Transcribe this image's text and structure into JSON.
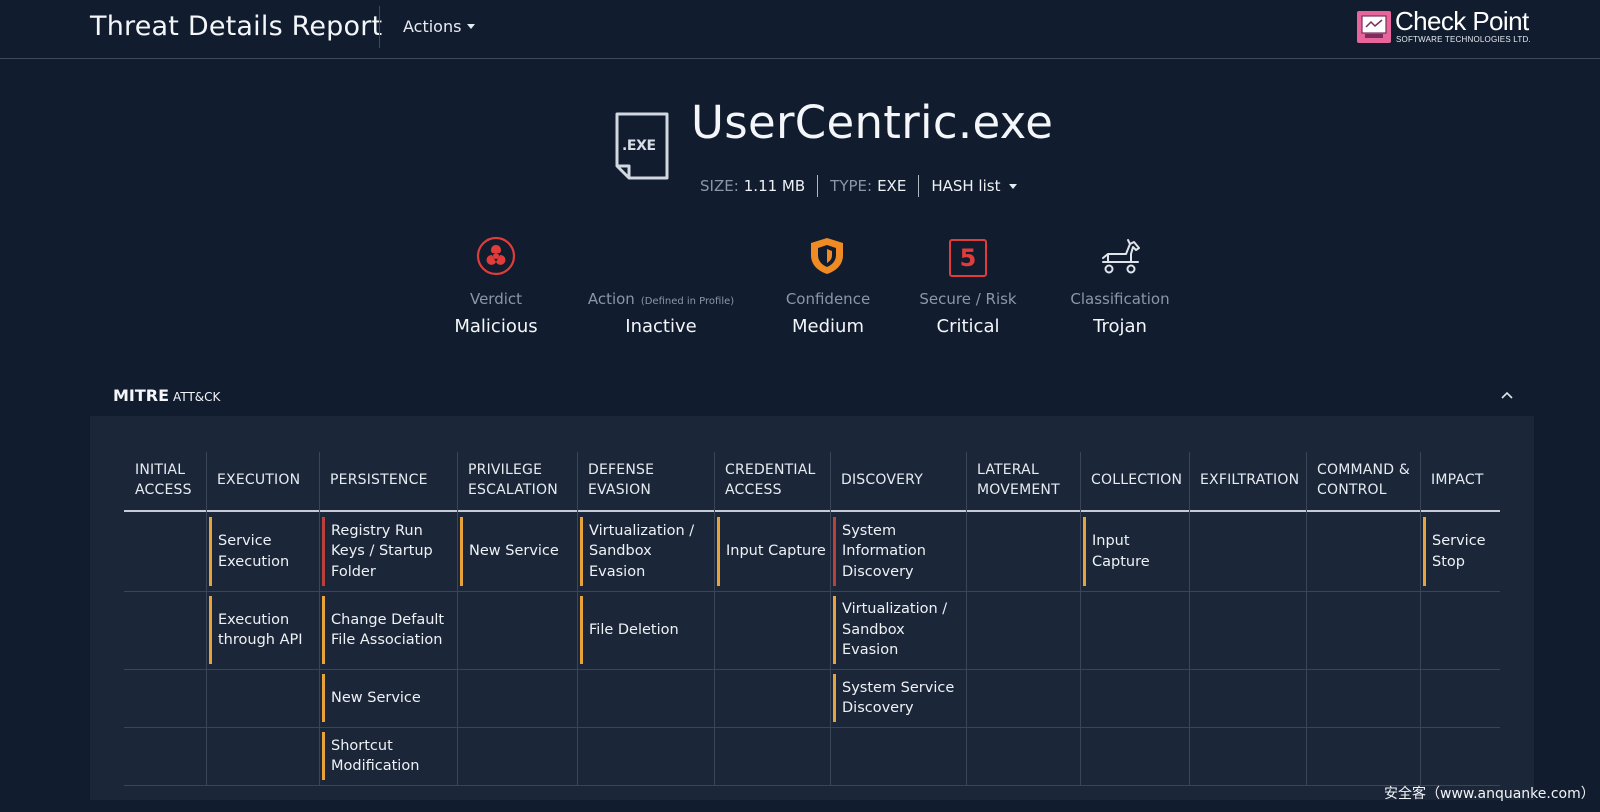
{
  "header": {
    "title": "Threat Details Report",
    "actions_label": "Actions",
    "brand_name": "Check Point",
    "brand_sub": "SOFTWARE TECHNOLOGIES LTD."
  },
  "file": {
    "ext_label": ".EXE",
    "name": "UserCentric.exe",
    "size_label": "SIZE:",
    "size_value": "1.11 MB",
    "type_label": "TYPE:",
    "type_value": "EXE",
    "hash_label": "HASH list"
  },
  "summary": {
    "verdict": {
      "label": "Verdict",
      "value": "Malicious",
      "icon": "biohazard-icon",
      "color": "#e03c3c"
    },
    "action": {
      "label": "Action",
      "note": "(Defined in Profile)",
      "value": "Inactive"
    },
    "confidence": {
      "label": "Confidence",
      "value": "Medium",
      "icon": "shield-icon",
      "color": "#f08a24"
    },
    "risk": {
      "label": "Secure / Risk",
      "value": "Critical",
      "score": "5",
      "color": "#e03c3c"
    },
    "classification": {
      "label": "Classification",
      "value": "Trojan",
      "icon": "trojan-horse-icon"
    }
  },
  "mitre": {
    "title_bold": "MITRE",
    "title_rest": "ATT&CK",
    "columns": [
      [
        "INITIAL",
        "ACCESS"
      ],
      [
        "EXECUTION"
      ],
      [
        "PERSISTENCE"
      ],
      [
        "PRIVILEGE",
        "ESCALATION"
      ],
      [
        "DEFENSE",
        "EVASION"
      ],
      [
        "CREDENTIAL",
        "ACCESS"
      ],
      [
        "DISCOVERY"
      ],
      [
        "LATERAL",
        "MOVEMENT"
      ],
      [
        "COLLECTION"
      ],
      [
        "EXFILTRATION"
      ],
      [
        "COMMAND &",
        "CONTROL"
      ],
      [
        "IMPACT"
      ]
    ],
    "cells": [
      {
        "col": 1,
        "row": 0,
        "lines": [
          "Service",
          "Execution"
        ],
        "severity": "medium"
      },
      {
        "col": 2,
        "row": 0,
        "lines": [
          "Registry Run",
          "Keys / Startup",
          "Folder"
        ],
        "severity": "high"
      },
      {
        "col": 3,
        "row": 0,
        "lines": [
          "New Service"
        ],
        "severity": "medium"
      },
      {
        "col": 4,
        "row": 0,
        "lines": [
          "Virtualization /",
          "Sandbox",
          "Evasion"
        ],
        "severity": "medium"
      },
      {
        "col": 5,
        "row": 0,
        "lines": [
          "Input Capture"
        ],
        "severity": "medium"
      },
      {
        "col": 6,
        "row": 0,
        "lines": [
          "System",
          "Information",
          "Discovery"
        ],
        "severity": "high"
      },
      {
        "col": 8,
        "row": 0,
        "lines": [
          "Input",
          "Capture"
        ],
        "severity": "medium"
      },
      {
        "col": 11,
        "row": 0,
        "lines": [
          "Service",
          "Stop"
        ],
        "severity": "medium"
      },
      {
        "col": 1,
        "row": 1,
        "lines": [
          "Execution",
          "through API"
        ],
        "severity": "medium"
      },
      {
        "col": 2,
        "row": 1,
        "lines": [
          "Change Default",
          "File Association"
        ],
        "severity": "medium"
      },
      {
        "col": 4,
        "row": 1,
        "lines": [
          "File Deletion"
        ],
        "severity": "medium"
      },
      {
        "col": 6,
        "row": 1,
        "lines": [
          "Virtualization /",
          "Sandbox",
          "Evasion"
        ],
        "severity": "medium"
      },
      {
        "col": 2,
        "row": 2,
        "lines": [
          "New Service"
        ],
        "severity": "medium"
      },
      {
        "col": 6,
        "row": 2,
        "lines": [
          "System Service",
          "Discovery"
        ],
        "severity": "medium"
      },
      {
        "col": 2,
        "row": 3,
        "lines": [
          "Shortcut",
          "Modification"
        ],
        "severity": "medium"
      }
    ],
    "severity_colors": {
      "medium": "#e7a23a",
      "high": "#b9413a"
    }
  },
  "watermark": "安全客（www.anquanke.com）"
}
